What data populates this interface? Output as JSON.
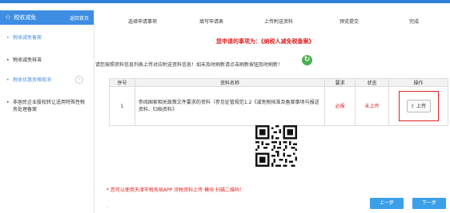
{
  "sidebar": {
    "title": "税收减免",
    "home_link": "返回首页",
    "items": [
      {
        "label": "税收减免备案"
      },
      {
        "label": "税收减免核准"
      },
      {
        "label": "税收优惠资格取消"
      },
      {
        "label": "非居民企业股权转让适用特殊性税务处理备案"
      }
    ]
  },
  "steps": [
    {
      "label": "选择申请事项"
    },
    {
      "label": "填写申请表"
    },
    {
      "label": "上传附送资料"
    },
    {
      "label": "预览提交"
    },
    {
      "label": "完成"
    }
  ],
  "notice": "您申请的事项为：《纳税人减免税备案》",
  "instruction": "请您按照资料信息列表上传对应附送资料信息！如未及时刷新请点击刷新按钮及时刷新！",
  "table": {
    "headers": [
      "序号",
      "资料名称",
      "要求",
      "状态",
      "操作"
    ],
    "rows": [
      {
        "index": "1",
        "name": "参阅国家相关政策文件要求的资料（参见征管规范1.2《减免税核准及备案事项与报送资料、归档资料》",
        "requirement": "必报",
        "status": "未上传",
        "action": "上传"
      }
    ]
  },
  "qr_note": "* 您可以使用天津市税务局APP 涉税资料上传 模块 扫描二维码！",
  "dot": ".",
  "buttons": {
    "prev": "上一步",
    "next": "下一步"
  },
  "colors": {
    "accent": "#3d8ee2",
    "warning": "#e02020",
    "refresh": "#4caf50",
    "button": "#3aa0e8"
  }
}
